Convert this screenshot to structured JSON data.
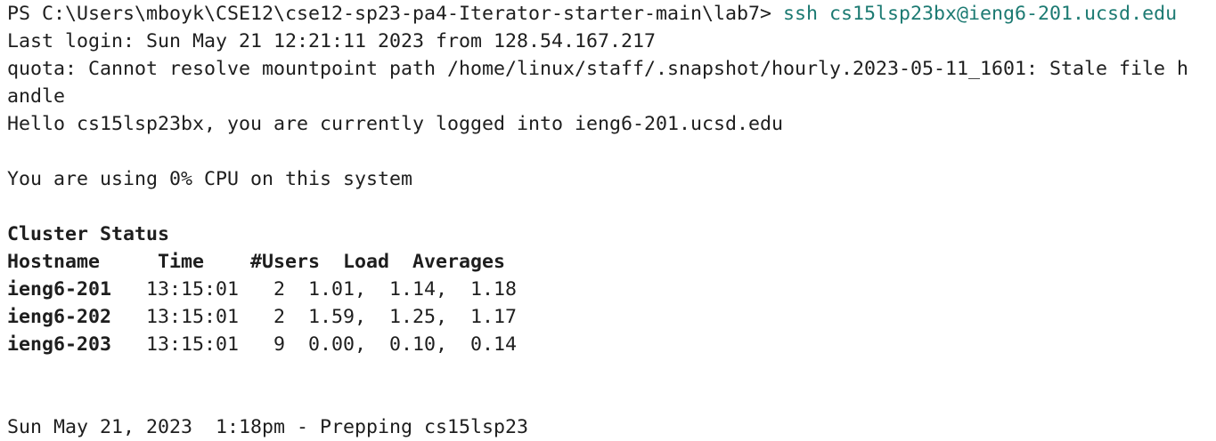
{
  "prompt": "PS C:\\Users\\mboyk\\CSE12\\cse12-sp23-pa4-Iterator-starter-main\\lab7> ",
  "command": "ssh cs15lsp23bx@ieng6-201.ucsd.edu",
  "colors": {
    "background": "#ffffff",
    "text": "#1e1e1e",
    "command": "#1c7a72"
  },
  "lines": {
    "last_login": "Last login: Sun May 21 12:21:11 2023 from 128.54.167.217",
    "quota_1": "quota: Cannot resolve mountpoint path /home/linux/staff/.snapshot/hourly.2023-05-11_1601: Stale file h",
    "quota_2": "andle",
    "hello": "Hello cs15lsp23bx, you are currently logged into ieng6-201.ucsd.edu",
    "cpu": "You are using 0% CPU on this system",
    "cluster_title": "Cluster Status",
    "header": "Hostname     Time    #Users  Load  Averages",
    "footer": "Sun May 21, 2023  1:18pm - Prepping cs15lsp23"
  },
  "rows": [
    {
      "host": "ieng6-201",
      "rest": "   13:15:01   2  1.01,  1.14,  1.18"
    },
    {
      "host": "ieng6-202",
      "rest": "   13:15:01   2  1.59,  1.25,  1.17"
    },
    {
      "host": "ieng6-203",
      "rest": "   13:15:01   9  0.00,  0.10,  0.14"
    }
  ]
}
